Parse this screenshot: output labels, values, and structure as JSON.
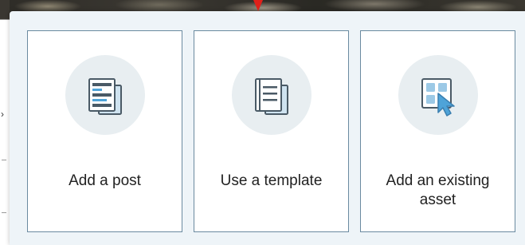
{
  "popup": {
    "options": [
      {
        "label": "Add a post",
        "icon": "post-document-icon"
      },
      {
        "label": "Use a template",
        "icon": "template-document-icon"
      },
      {
        "label": "Add an existing asset",
        "icon": "asset-grid-pointer-icon"
      }
    ]
  },
  "colors": {
    "pointer": "#e0201a",
    "card_border": "#6a8aa0",
    "icon_circle": "#e8eef1",
    "icon_dark": "#4a5a66",
    "icon_accent": "#4ea3d8",
    "popup_bg": "#eef4f8"
  }
}
